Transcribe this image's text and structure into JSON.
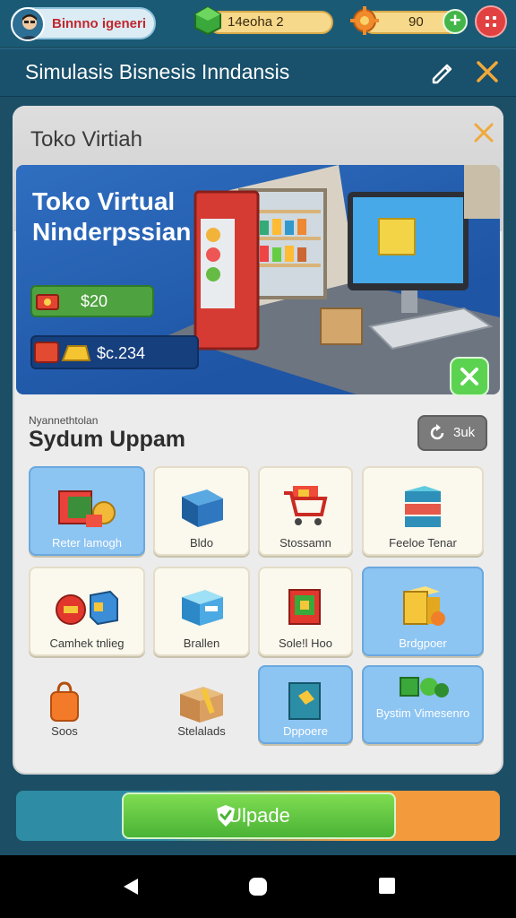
{
  "player": {
    "name": "Binnno igeneri"
  },
  "currency": {
    "gems": "14eoha 2",
    "coins": "90",
    "add": "+"
  },
  "header": {
    "title": "Simulasis Bisnesis Inndansis"
  },
  "panel": {
    "title": "Toko Virtiah",
    "banner": {
      "title": "Toko Virtual Ninderpssian",
      "stat1": "$20",
      "stat2": "$c.234"
    },
    "subtitle": "Nyannethtolan",
    "section_title": "Sydum Uppam",
    "sort_label": "3uk"
  },
  "items": [
    {
      "label": "Reter lamogh"
    },
    {
      "label": "Bldo"
    },
    {
      "label": "Stossamn"
    },
    {
      "label": "Feeloe Tenar"
    },
    {
      "label": "Camhek tnlieg"
    },
    {
      "label": "Brallen"
    },
    {
      "label": "Sole!l Hoo"
    },
    {
      "label": "Brdgpoer"
    },
    {
      "label": "Soos"
    },
    {
      "label": "Stelalads"
    },
    {
      "label": "Dppoere"
    },
    {
      "label": "Bystim Vimesenro"
    }
  ],
  "footer": {
    "upgrade_label": "Ulpade"
  }
}
